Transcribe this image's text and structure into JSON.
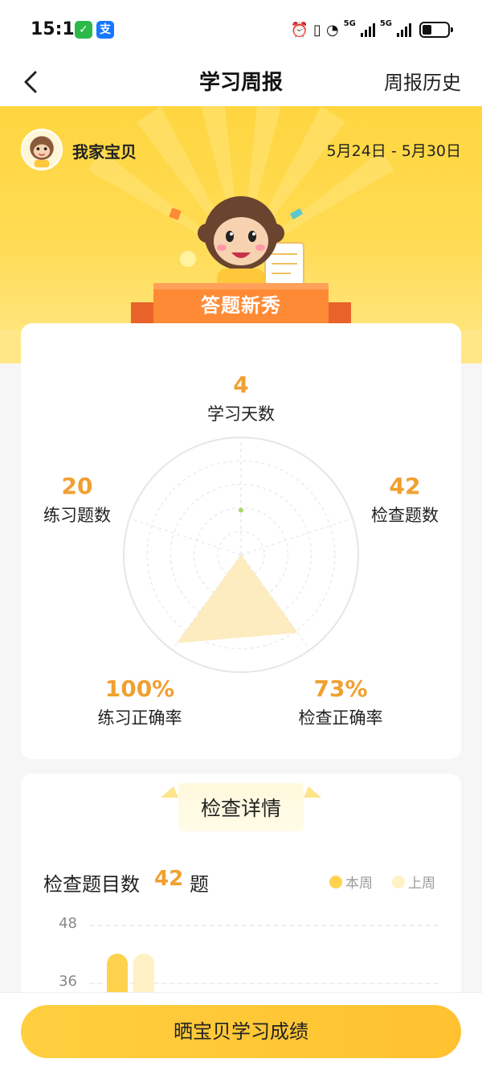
{
  "status_bar": {
    "time": "15:15",
    "apps": [
      "wechat-icon",
      "alipay-icon"
    ],
    "network_labels": [
      "5G",
      "5G"
    ]
  },
  "nav": {
    "title": "学习周报",
    "history_link": "周报历史"
  },
  "header": {
    "child_name": "我家宝贝",
    "date_range": "5月24日 - 5月30日",
    "badge_title": "答题新秀"
  },
  "stats": {
    "study_days": {
      "value": "4",
      "label": "学习天数"
    },
    "practice_count": {
      "value": "20",
      "label": "练习题数"
    },
    "check_count": {
      "value": "42",
      "label": "检查题数"
    },
    "practice_accuracy": {
      "value": "100%",
      "label": "练习正确率"
    },
    "check_accuracy": {
      "value": "73%",
      "label": "检查正确率"
    }
  },
  "radar_data": {
    "type": "radar",
    "axes": [
      "学习天数",
      "检查题数",
      "检查正确率",
      "练习正确率",
      "练习题数"
    ],
    "values": [
      0.38,
      0.0,
      0.82,
      0.93,
      0.0
    ]
  },
  "check_detail": {
    "title": "检查详情",
    "count_label": "检查题目数",
    "count_value": "42",
    "count_unit": "题",
    "legend_this_week": "本周",
    "legend_last_week": "上周",
    "chart_data": {
      "type": "bar",
      "y_ticks": [
        "48",
        "36"
      ],
      "series": [
        {
          "name": "本周",
          "color": "#ffd24d"
        },
        {
          "name": "上周",
          "color": "#fff1c4"
        }
      ]
    }
  },
  "share_button": "晒宝贝学习成绩",
  "colors": {
    "brand_yellow": "#ffd640",
    "accent_orange": "#f0a030",
    "ribbon_orange": "#ff8a35"
  }
}
